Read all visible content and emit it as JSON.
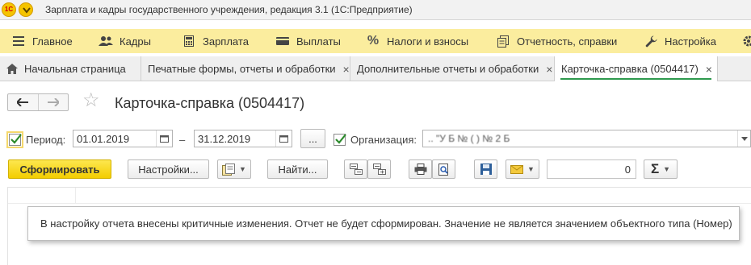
{
  "title_bar": {
    "logo_text": "1С",
    "title": "Зарплата и кадры государственного учреждения, редакция 3.1  (1С:Предприятие)"
  },
  "sections": [
    {
      "label": "Главное",
      "icon": "hamburger-icon"
    },
    {
      "label": "Кадры",
      "icon": "people-icon"
    },
    {
      "label": "Зарплата",
      "icon": "calculator-icon"
    },
    {
      "label": "Выплаты",
      "icon": "wallet-icon"
    },
    {
      "label": "Налоги и взносы",
      "icon": "percent-icon"
    },
    {
      "label": "Отчетность, справки",
      "icon": "documents-icon"
    },
    {
      "label": "Настройка",
      "icon": "wrench-icon"
    }
  ],
  "tabs": [
    {
      "label": "Начальная страница",
      "icon": "home-icon",
      "closable": false
    },
    {
      "label": "Печатные формы, отчеты и обработки",
      "closable": true
    },
    {
      "label": "Дополнительные отчеты и обработки",
      "closable": true
    },
    {
      "label": "Карточка-справка (0504417)",
      "closable": true,
      "active": true
    }
  ],
  "tab_close_symbol": "×",
  "form": {
    "title": "Карточка-справка (0504417)",
    "period_label": "Период:",
    "period_checked": true,
    "date_from": "01.01.2019",
    "date_dash": "–",
    "date_to": "31.12.2019",
    "period_button": "...",
    "org_label": "Организация:",
    "org_checked": true,
    "org_value": "..  \"У Б         №  ( )   № 2  Б"
  },
  "toolbar": {
    "generate": "Сформировать",
    "settings": "Настройки...",
    "find": "Найти...",
    "sum_value": "0",
    "sigma": "Σ"
  },
  "message": "В настройку отчета внесены критичные изменения. Отчет не будет сформирован. Значение не является значением объектного типа (Номер)",
  "colors": {
    "section_bar": "#fbed9e",
    "primary_button": "#f3cd00",
    "active_tab_underline": "#2e9a4e"
  }
}
